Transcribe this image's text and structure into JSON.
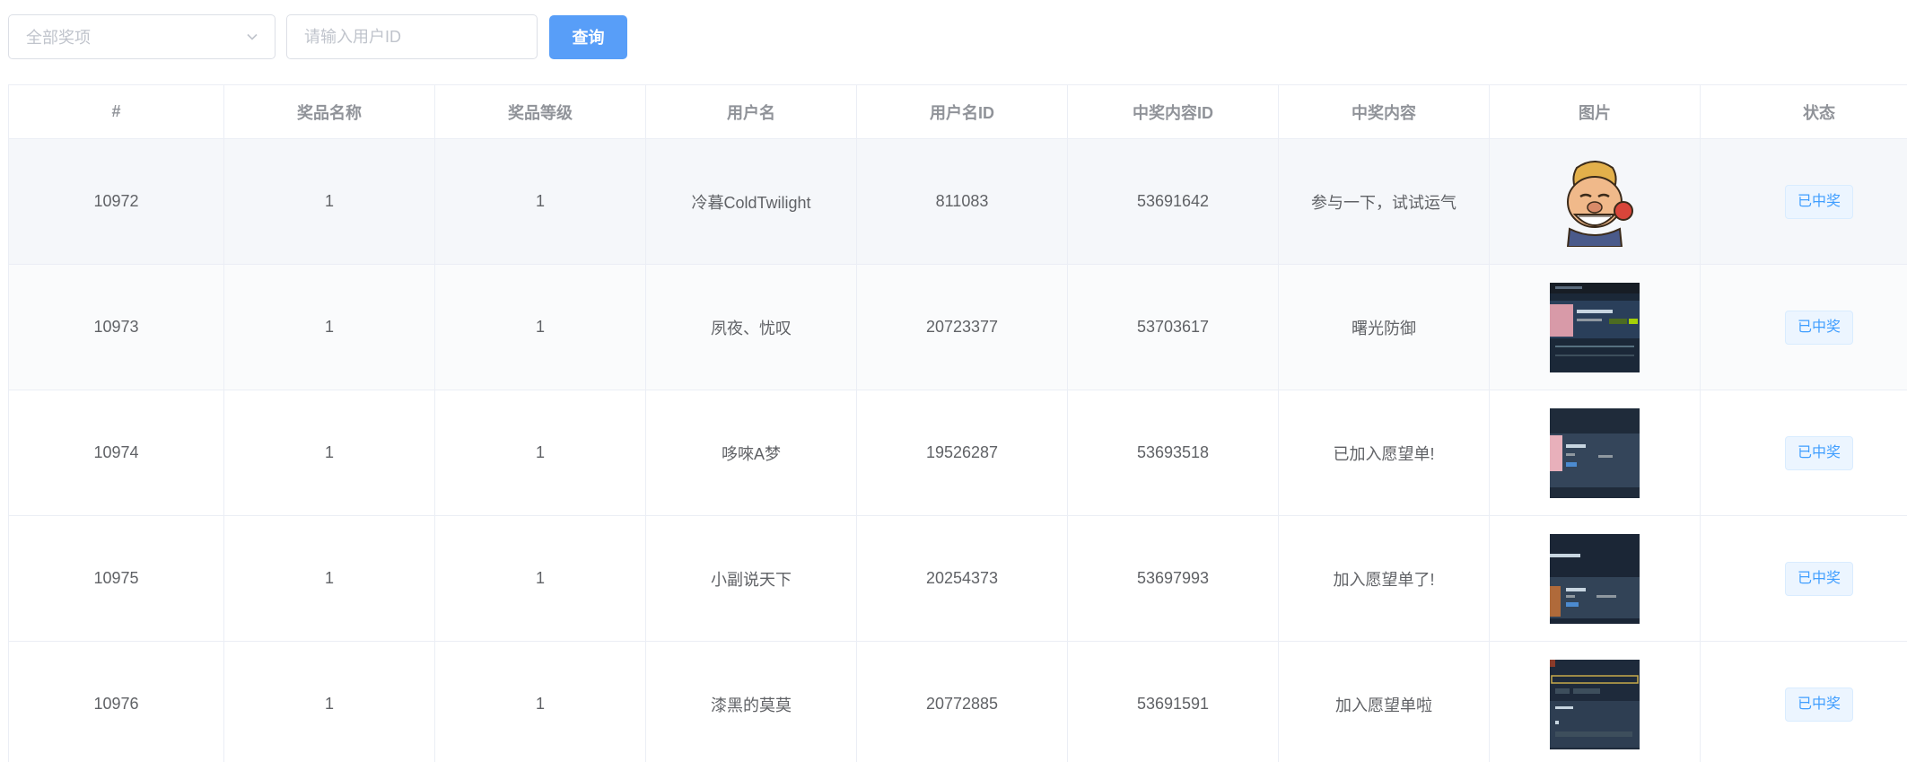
{
  "filters": {
    "prize_select_value": "全部奖项",
    "user_id_placeholder": "请输入用户ID",
    "query_button": "查询"
  },
  "table": {
    "headers": [
      "#",
      "奖品名称",
      "奖品等级",
      "用户名",
      "用户名ID",
      "中奖内容ID",
      "中奖内容",
      "图片",
      "状态"
    ],
    "rows": [
      {
        "id": "10972",
        "prize_name": "1",
        "prize_level": "1",
        "username": "冷暮ColdTwilight",
        "user_id": "811083",
        "content_id": "53691642",
        "content": "参与一下，试试运气",
        "image": "cartoon-avatar",
        "status": "已中奖"
      },
      {
        "id": "10973",
        "prize_name": "1",
        "prize_level": "1",
        "username": "夙夜、忧叹",
        "user_id": "20723377",
        "content_id": "53703617",
        "content": "曙光防御",
        "image": "store-screenshot",
        "status": "已中奖"
      },
      {
        "id": "10974",
        "prize_name": "1",
        "prize_level": "1",
        "username": "哆唻A梦",
        "user_id": "19526287",
        "content_id": "53693518",
        "content": "已加入愿望单!",
        "image": "store-screenshot",
        "status": "已中奖"
      },
      {
        "id": "10975",
        "prize_name": "1",
        "prize_level": "1",
        "username": "小副说天下",
        "user_id": "20254373",
        "content_id": "53697993",
        "content": "加入愿望单了!",
        "image": "store-screenshot",
        "status": "已中奖"
      },
      {
        "id": "10976",
        "prize_name": "1",
        "prize_level": "1",
        "username": "漆黑的莫莫",
        "user_id": "20772885",
        "content_id": "53691591",
        "content": "加入愿望单啦",
        "image": "store-screenshot",
        "status": "已中奖"
      }
    ]
  }
}
